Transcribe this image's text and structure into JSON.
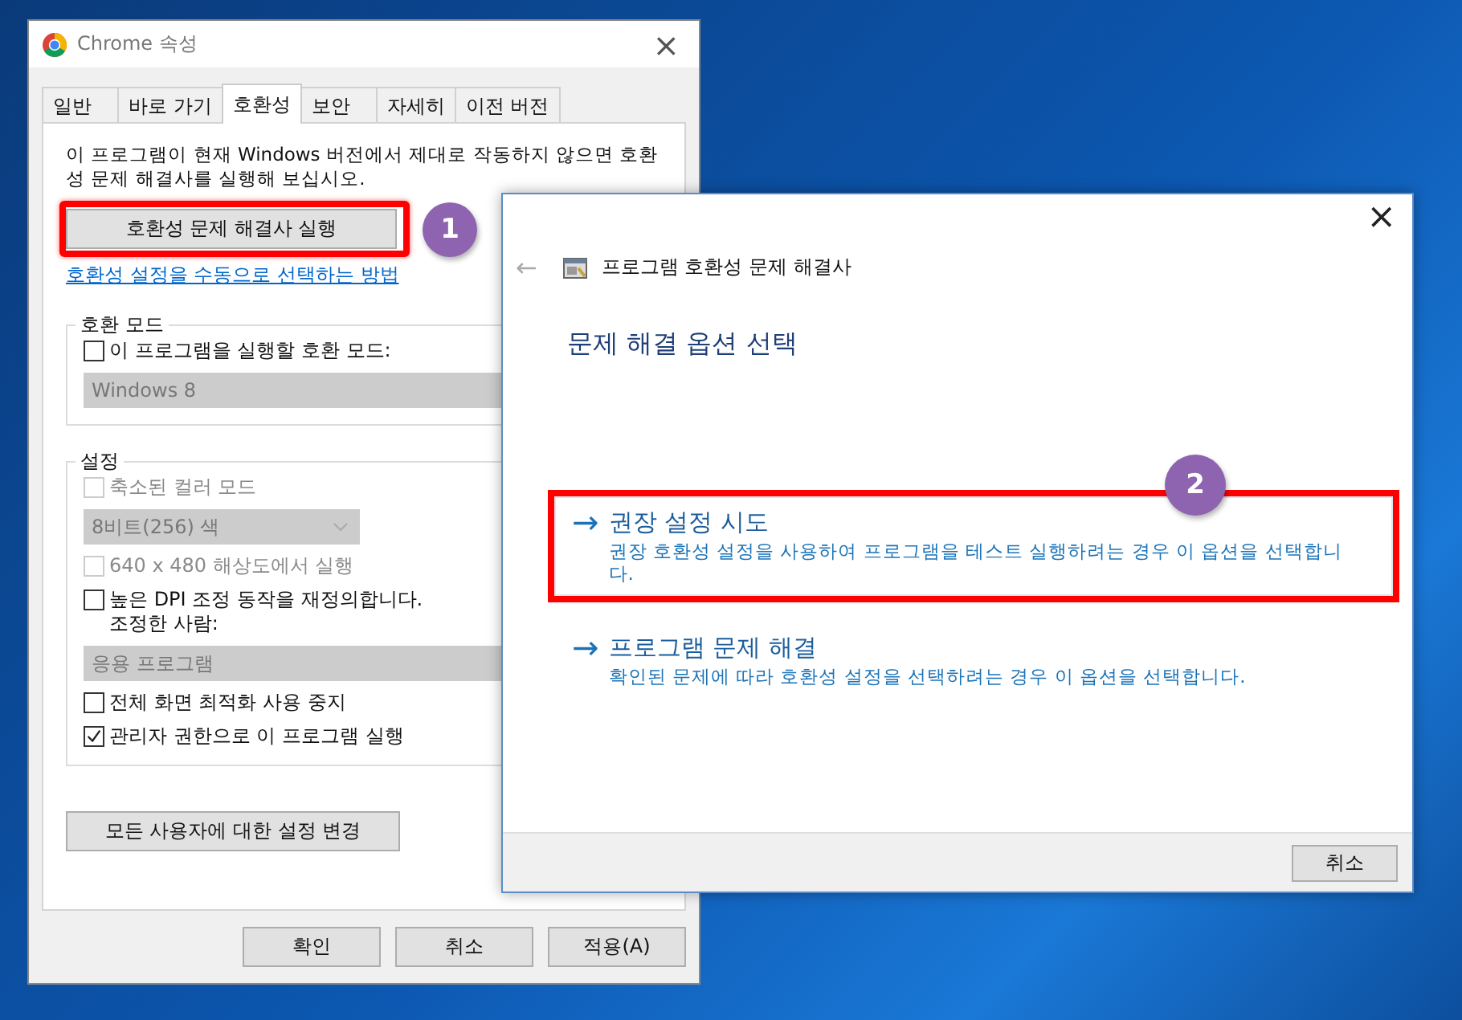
{
  "properties_window": {
    "title": "Chrome 속성",
    "tabs": [
      {
        "label": "일반",
        "selected": false
      },
      {
        "label": "바로 가기",
        "selected": false
      },
      {
        "label": "호환성",
        "selected": true
      },
      {
        "label": "보안",
        "selected": false
      },
      {
        "label": "자세히",
        "selected": false
      },
      {
        "label": "이전 버전",
        "selected": false
      }
    ],
    "intro": "이 프로그램이 현재 Windows 버전에서 제대로 작동하지 않으면 호환성 문제 해결사를 실행해 보십시오.",
    "troubleshoot_button": {
      "label": "호환성 문제 해결사 실행",
      "highlighted": true,
      "badge": "1"
    },
    "manual_link": "호환성 설정을 수동으로 선택하는 방법",
    "compat_mode": {
      "legend": "호환 모드",
      "items": [
        {
          "kind": "checkbox",
          "label": "이 프로그램을 실행할 호환 모드:",
          "checked": false,
          "disabled": false
        },
        {
          "kind": "dropdown",
          "value": "Windows 8",
          "disabled": true,
          "wide": true
        }
      ]
    },
    "settings": {
      "legend": "설정",
      "items": [
        {
          "kind": "checkbox",
          "label": "축소된 컬러 모드",
          "checked": false,
          "disabled": true
        },
        {
          "kind": "dropdown",
          "value": "8비트(256) 색",
          "disabled": true,
          "wide": false
        },
        {
          "kind": "checkbox",
          "label": "640 x 480 해상도에서 실행",
          "checked": false,
          "disabled": true
        },
        {
          "kind": "checkbox",
          "label": "높은 DPI 조정 동작을 재정의합니다.\n조정한 사람:",
          "checked": false,
          "disabled": false
        },
        {
          "kind": "dropdown",
          "value": "응용 프로그램",
          "disabled": true,
          "wide": true
        },
        {
          "kind": "checkbox",
          "label": "전체 화면 최적화 사용 중지",
          "checked": false,
          "disabled": false
        },
        {
          "kind": "checkbox",
          "label": "관리자 권한으로 이 프로그램 실행",
          "checked": true,
          "disabled": false
        }
      ]
    },
    "all_users_button": "모든 사용자에 대한 설정 변경",
    "buttons": [
      "확인",
      "취소",
      "적용(A)"
    ]
  },
  "troubleshooter_window": {
    "close": "×",
    "back": "←",
    "title": "프로그램 호환성 문제 해결사",
    "heading": "문제 해결 옵션 선택",
    "options": [
      {
        "arrow": "→",
        "title": "권장 설정 시도",
        "description": "권장 호환성 설정을 사용하여 프로그램을 테스트 실행하려는 경우 이 옵션을 선택합니다.",
        "selected": true,
        "highlighted": true,
        "badge": "2"
      },
      {
        "arrow": "→",
        "title": "프로그램 문제 해결",
        "description": "확인된 문제에 따라 호환성 설정을 선택하려는 경우 이 옵션을 선택합니다.",
        "selected": false,
        "highlighted": false
      }
    ],
    "cancel_button": "취소"
  }
}
